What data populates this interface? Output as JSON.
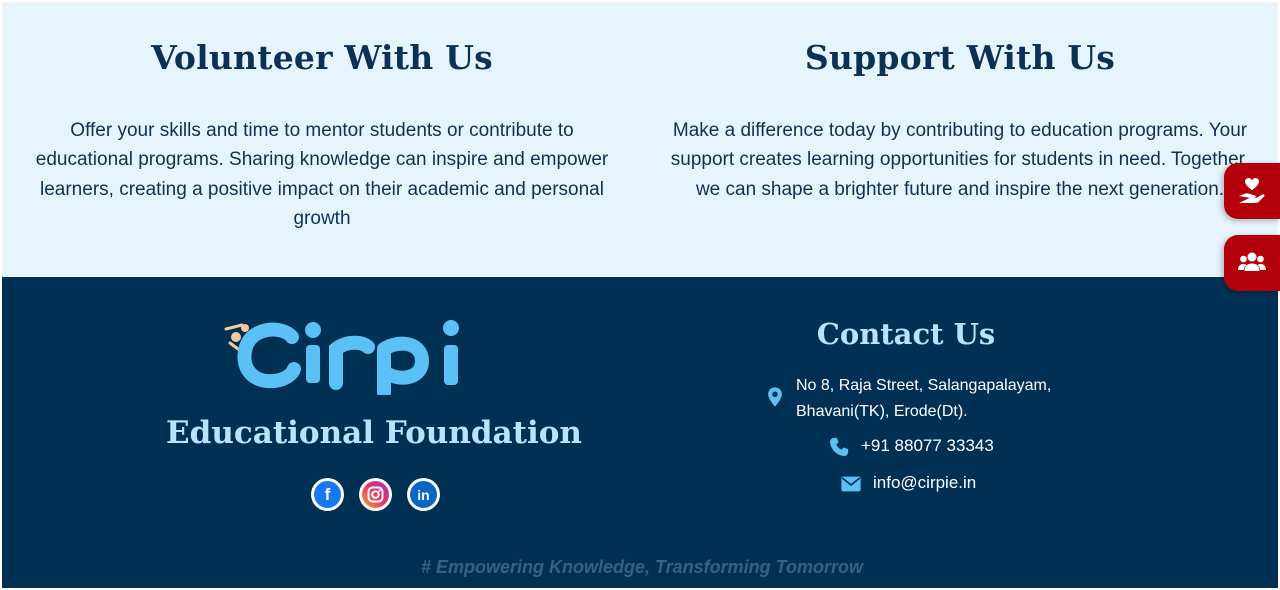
{
  "volunteer": {
    "title": "Volunteer With Us",
    "text": "Offer your skills and time to mentor students or contribute to educational programs. Sharing knowledge can inspire and empower learners, creating a positive impact on their academic and personal growth"
  },
  "support": {
    "title": "Support With Us",
    "text": "Make a difference today by contributing to education programs. Your support creates learning opportunities for students in need. Together, we can shape a brighter future and inspire the next generation."
  },
  "footer": {
    "logo_text": "Cirpi",
    "foundation": "Educational Foundation",
    "socials": [
      {
        "icon": "facebook-icon",
        "label": "f"
      },
      {
        "icon": "instagram-icon",
        "label": "◎"
      },
      {
        "icon": "linkedin-icon",
        "label": "in"
      }
    ],
    "contact": {
      "title": "Contact Us",
      "address_line1": "No 8, Raja Street, Salangapalayam,",
      "address_line2": "Bhavani(TK), Erode(Dt).",
      "phone": "+91 88077 33343",
      "email": "info@cirpie.in"
    },
    "tagline": "# Empowering Knowledge, Transforming Tomorrow"
  },
  "side_buttons": [
    {
      "icon": "donate-hand-heart-icon"
    },
    {
      "icon": "users-group-icon"
    }
  ],
  "colors": {
    "top_bg": "#e6f4fd",
    "heading": "#0d3155",
    "footer_bg": "#003155",
    "footer_heading": "#b9e2fb",
    "accent_blue": "#5bc0f5",
    "side_button": "#b3000a"
  }
}
